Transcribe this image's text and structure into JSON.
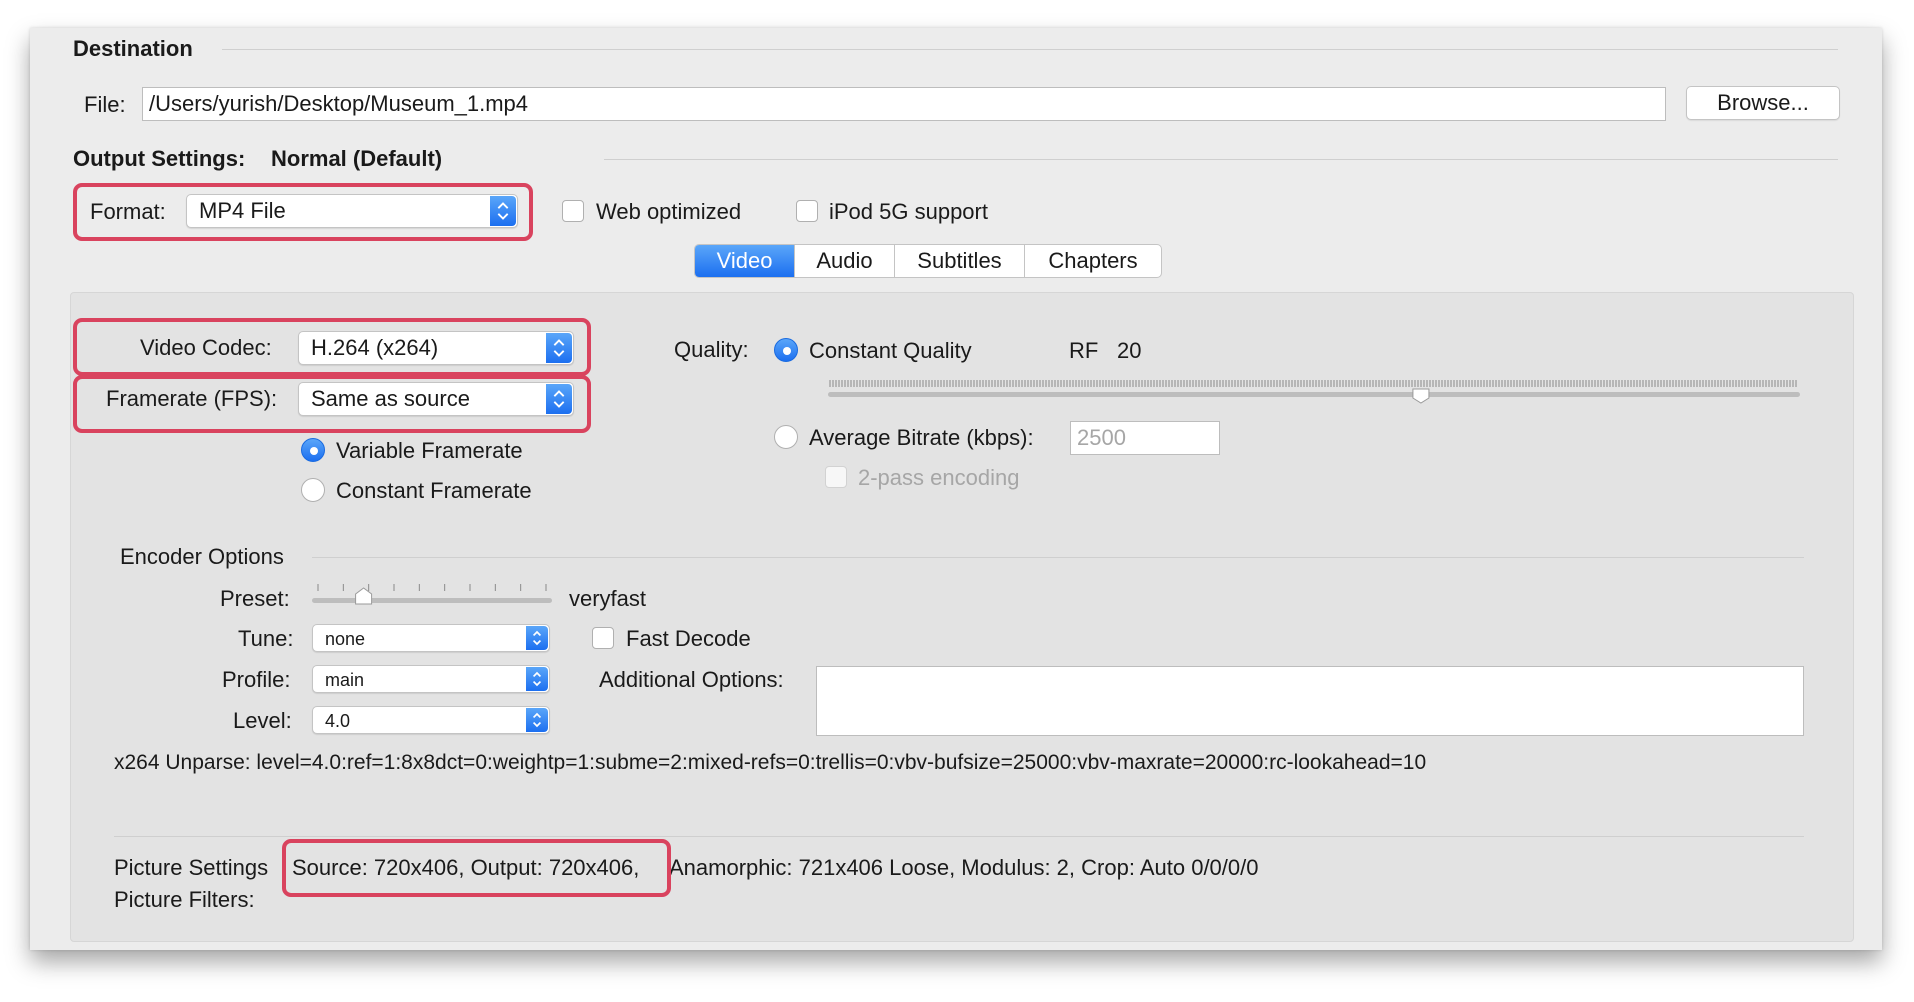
{
  "destination": {
    "title": "Destination",
    "file_label": "File:",
    "file_path": "/Users/yurish/Desktop/Museum_1.mp4",
    "browse_label": "Browse..."
  },
  "output": {
    "title": "Output Settings:",
    "preset_name": "Normal (Default)",
    "format_label": "Format:",
    "format_value": "MP4 File",
    "web_optimized_label": "Web optimized",
    "ipod_label": "iPod 5G support"
  },
  "tabs": [
    {
      "label": "Video",
      "active": true
    },
    {
      "label": "Audio",
      "active": false
    },
    {
      "label": "Subtitles",
      "active": false
    },
    {
      "label": "Chapters",
      "active": false
    }
  ],
  "video": {
    "codec_label": "Video Codec:",
    "codec_value": "H.264 (x264)",
    "framerate_label": "Framerate (FPS):",
    "framerate_value": "Same as source",
    "variable_label": "Variable Framerate",
    "constant_label": "Constant Framerate",
    "quality_label": "Quality:",
    "constant_quality_label": "Constant Quality",
    "rf_label": "RF",
    "rf_value": "20",
    "quality_slider_fraction": 0.61,
    "avg_bitrate_label": "Average Bitrate (kbps):",
    "avg_bitrate_value": "2500",
    "twopass_label": "2-pass encoding"
  },
  "encoder": {
    "title": "Encoder Options",
    "preset_label": "Preset:",
    "preset_value": "veryfast",
    "preset_slider_fraction": 0.2,
    "tune_label": "Tune:",
    "tune_value": "none",
    "fast_decode_label": "Fast Decode",
    "profile_label": "Profile:",
    "profile_value": "main",
    "level_label": "Level:",
    "level_value": "4.0",
    "additional_label": "Additional Options:",
    "unparse": "x264 Unparse: level=4.0:ref=1:8x8dct=0:weightp=1:subme=2:mixed-refs=0:trellis=0:vbv-bufsize=25000:vbv-maxrate=20000:rc-lookahead=10"
  },
  "picture": {
    "settings_label": "Picture Settings",
    "settings_highlight": "Source: 720x406, Output: 720x406,",
    "settings_rest": "Anamorphic: 721x406 Loose, Modulus: 2, Crop: Auto 0/0/0/0",
    "filters_label": "Picture Filters:"
  },
  "colors": {
    "accent": "#1c6ff0",
    "highlight": "#d9435e"
  }
}
